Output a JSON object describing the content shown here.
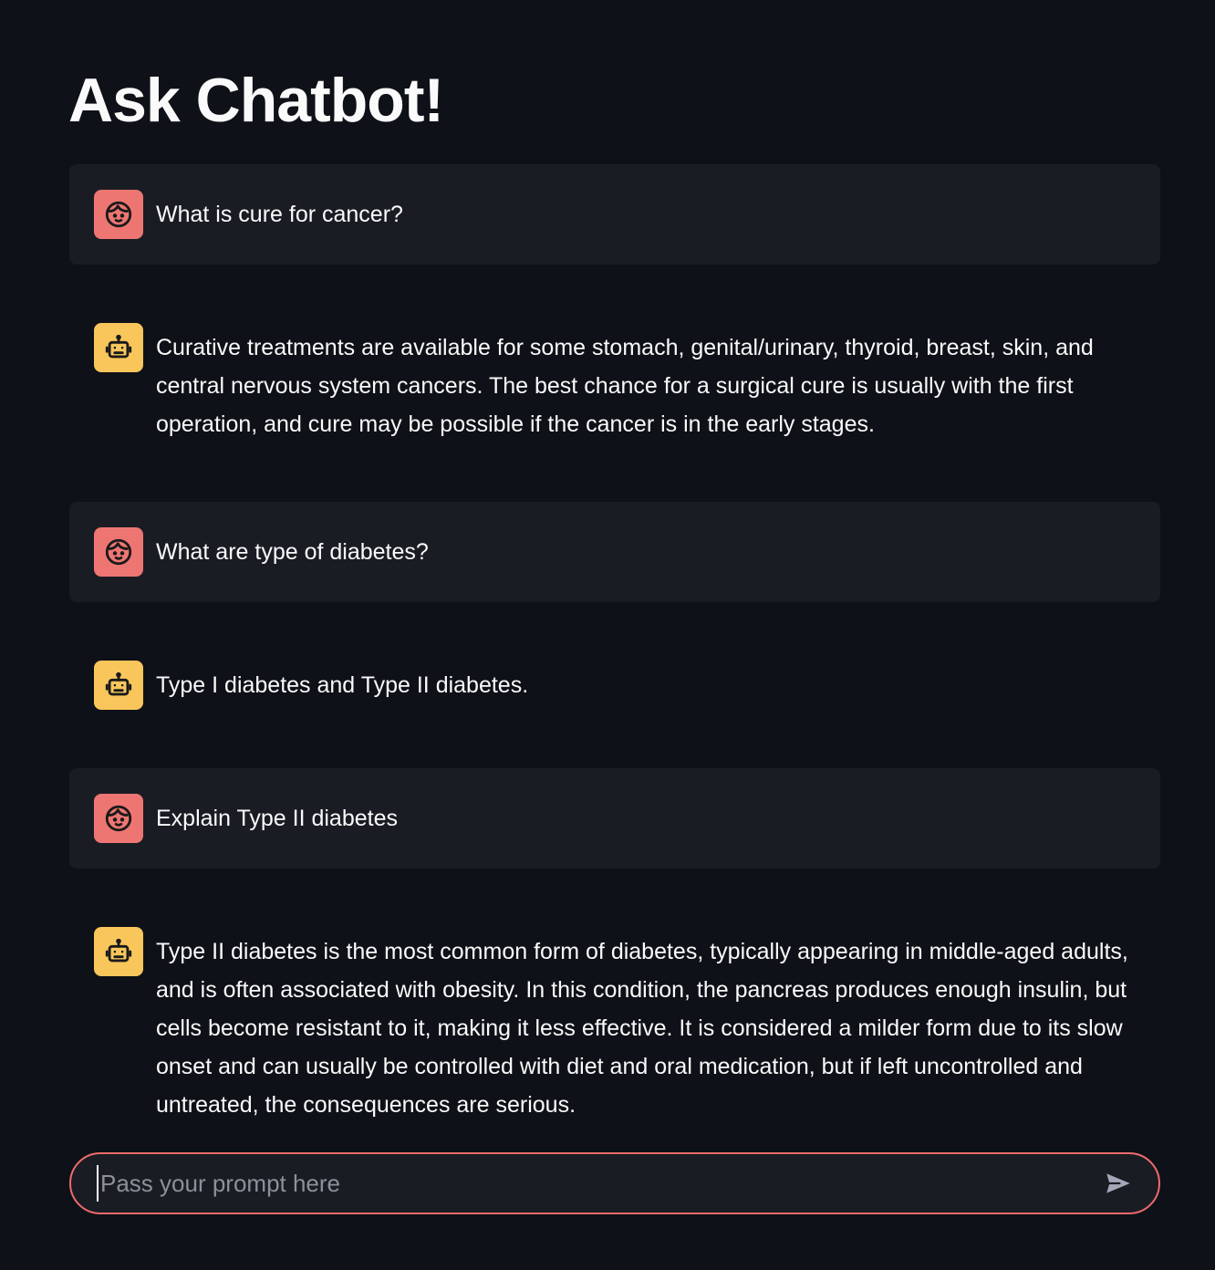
{
  "app": {
    "title": "Ask Chatbot!"
  },
  "colors": {
    "background": "#0e1117",
    "user_message_bg": "#1a1c24",
    "user_avatar": "#ee7672",
    "assistant_avatar": "#f9c65c",
    "input_border": "#ee6b6b"
  },
  "messages": [
    {
      "role": "user",
      "avatar_icon": "face-icon",
      "text": "What is cure for cancer?"
    },
    {
      "role": "assistant",
      "avatar_icon": "robot-icon",
      "text": "Curative treatments are available for some stomach, genital/urinary, thyroid, breast, skin, and central nervous system cancers. The best chance for a surgical cure is usually with the first operation, and cure may be possible if the cancer is in the early stages."
    },
    {
      "role": "user",
      "avatar_icon": "face-icon",
      "text": "What are type of diabetes?"
    },
    {
      "role": "assistant",
      "avatar_icon": "robot-icon",
      "text": "Type I diabetes and Type II diabetes."
    },
    {
      "role": "user",
      "avatar_icon": "face-icon",
      "text": "Explain Type II diabetes"
    },
    {
      "role": "assistant",
      "avatar_icon": "robot-icon",
      "text": "Type II diabetes is the most common form of diabetes, typically appearing in middle-aged adults, and is often associated with obesity. In this condition, the pancreas produces enough insulin, but cells become resistant to it, making it less effective. It is considered a milder form due to its slow onset and can usually be controlled with diet and oral medication, but if left uncontrolled and untreated, the consequences are serious."
    }
  ],
  "chat_input": {
    "placeholder": "Pass your prompt here",
    "value": "",
    "send_icon": "send-icon"
  }
}
